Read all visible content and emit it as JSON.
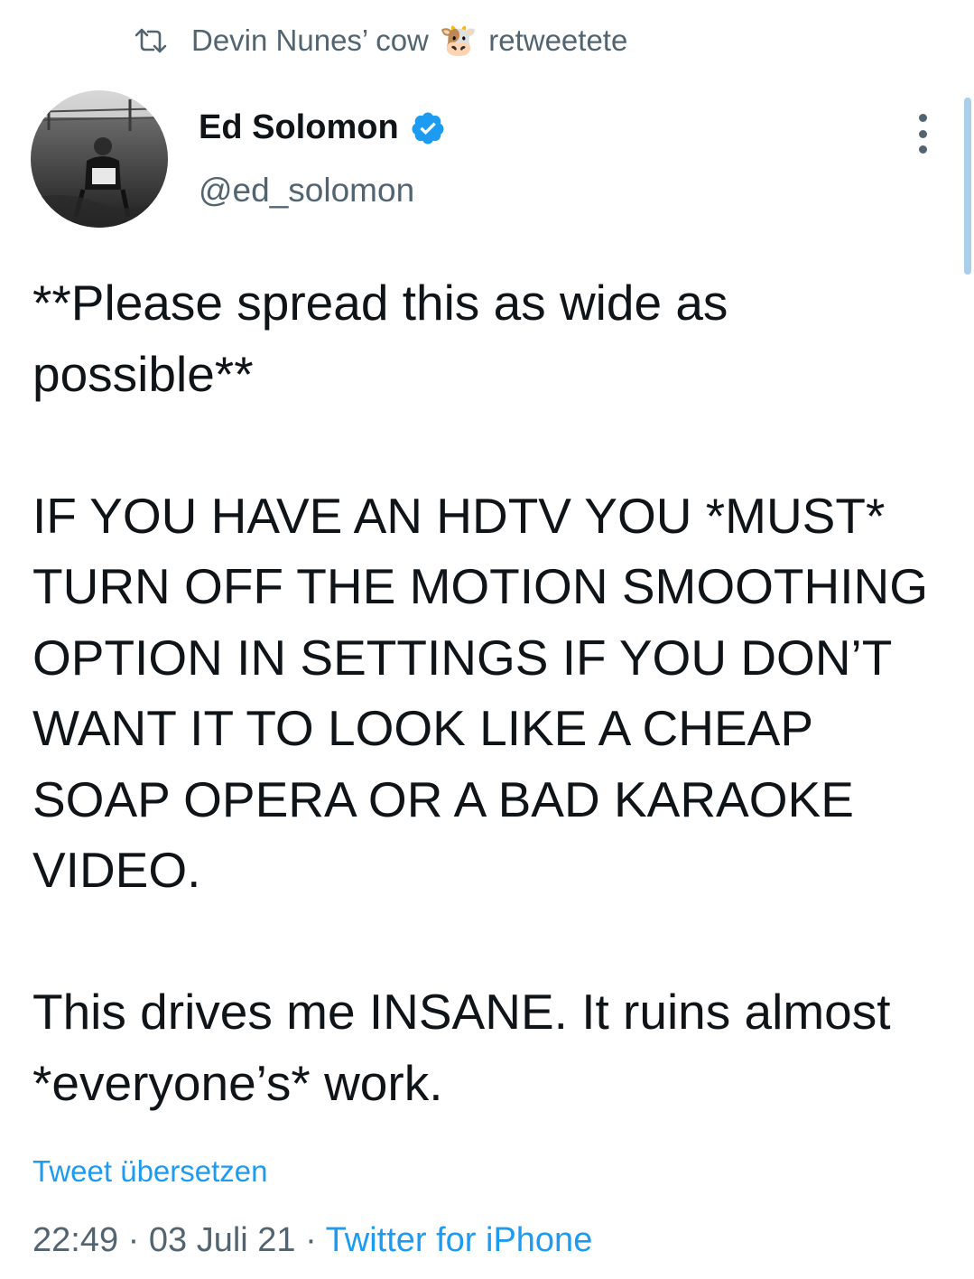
{
  "retweet": {
    "icon": "retweet-icon",
    "user": "Devin Nunes’ cow",
    "emoji": "🐮",
    "action": "retweetete"
  },
  "author": {
    "avatar_icon": "profile-photo",
    "name": "Ed Solomon",
    "verified_icon": "verified-badge-icon",
    "handle": "@ed_solomon"
  },
  "tweet": {
    "paragraphs": [
      "**Please spread this as wide as possible**",
      "IF YOU HAVE AN HDTV YOU *MUST* TURN OFF THE MOTION SMOOTHING OPTION IN SETTINGS IF YOU DON’T WANT IT TO LOOK LIKE A CHEAP SOAP OPERA OR A BAD KARAOKE VIDEO.",
      "This drives me INSANE. It ruins almost *everyone’s* work."
    ],
    "translate_label": "Tweet übersetzen"
  },
  "meta": {
    "time": "22:49",
    "separator": "·",
    "date": "03 Juli 21",
    "source": "Twitter for iPhone"
  },
  "colors": {
    "accent": "#1d9bf0",
    "secondary_text": "#536471",
    "primary_text": "#0f1419"
  }
}
